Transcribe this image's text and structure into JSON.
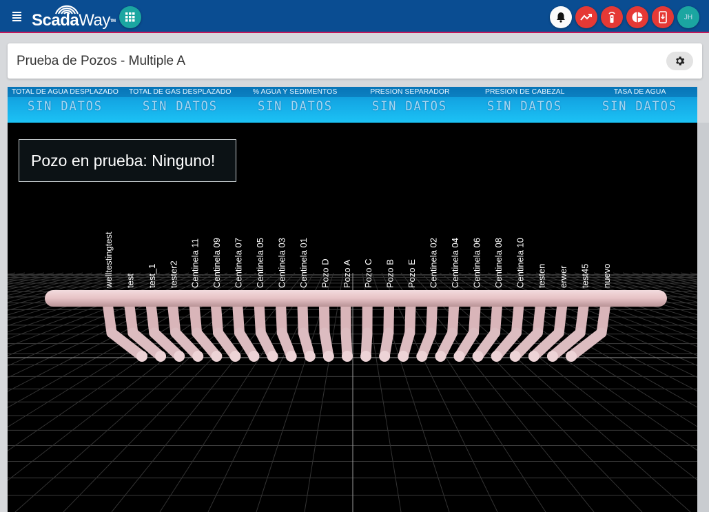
{
  "header": {
    "logo_text_a": "Scada",
    "logo_text_b": "Way",
    "logo_tm": "TM",
    "user_initials": "JH"
  },
  "page": {
    "title": "Prueba de Pozos - Multiple A"
  },
  "metrics": [
    {
      "label": "TOTAL DE AGUA DESPLAZADO",
      "value": "SIN DATOS"
    },
    {
      "label": "TOTAL DE GAS DESPLAZADO",
      "value": "SIN DATOS"
    },
    {
      "label": "% AGUA Y SEDIMENTOS",
      "value": "SIN DATOS"
    },
    {
      "label": "PRESION SEPARADOR",
      "value": "SIN DATOS"
    },
    {
      "label": "PRESION DE CABEZAL",
      "value": "SIN DATOS"
    },
    {
      "label": "TASA DE AGUA",
      "value": "SIN DATOS"
    }
  ],
  "scene": {
    "status": "Pozo en prueba: Ninguno!",
    "wells": [
      "welltestingtest",
      "test",
      "test_1",
      "tester2",
      "Centinela 11",
      "Centinela 09",
      "Centinela 07",
      "Centinela 05",
      "Centinela 03",
      "Centinela 01",
      "Pozo D",
      "Pozo A",
      "Pozo C",
      "Pozo B",
      "Pozo E",
      "Centinela 02",
      "Centinela 04",
      "Centinela 06",
      "Centinela 08",
      "Centinela 10",
      "testen",
      "erwer",
      "test45",
      "nuevo"
    ]
  },
  "colors": {
    "header_bg": "#0a4d92",
    "accent_red": "#e53935",
    "accent_teal": "#1ba6a1",
    "pipe": "#e8c5c9"
  }
}
